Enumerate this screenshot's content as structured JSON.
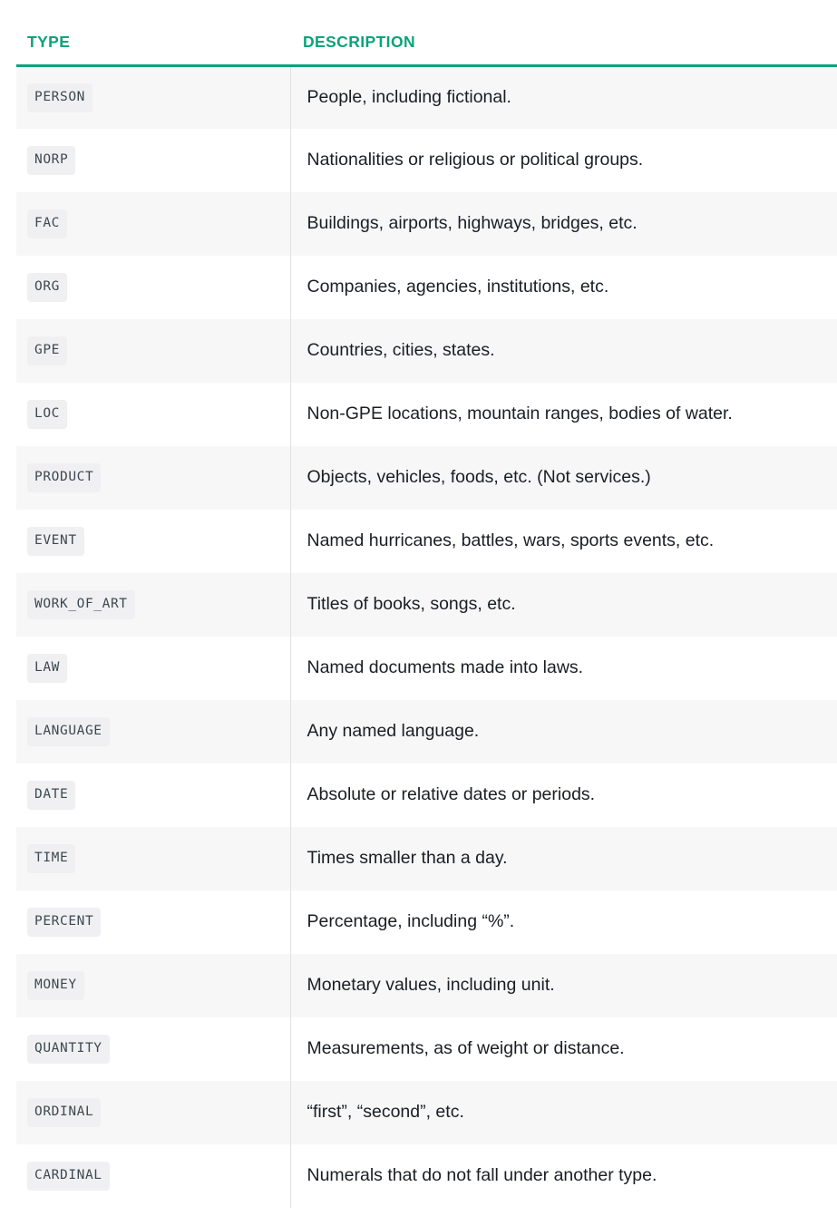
{
  "table": {
    "columns": [
      {
        "key": "type",
        "label": "TYPE"
      },
      {
        "key": "description",
        "label": "DESCRIPTION"
      }
    ],
    "header_accent_color": "#09a37a",
    "badge_background_color": "#f0f0f2",
    "badge_text_color": "#3d4852",
    "row_alt_background_color": "#f7f7f8",
    "row_background_color": "#ffffff",
    "divider_color": "#e1e1e4",
    "rows": [
      {
        "type": "PERSON",
        "description": "People, including fictional."
      },
      {
        "type": "NORP",
        "description": "Nationalities or religious or political groups."
      },
      {
        "type": "FAC",
        "description": "Buildings, airports, highways, bridges, etc."
      },
      {
        "type": "ORG",
        "description": "Companies, agencies, institutions, etc."
      },
      {
        "type": "GPE",
        "description": "Countries, cities, states."
      },
      {
        "type": "LOC",
        "description": "Non-GPE locations, mountain ranges, bodies of water."
      },
      {
        "type": "PRODUCT",
        "description": "Objects, vehicles, foods, etc. (Not services.)"
      },
      {
        "type": "EVENT",
        "description": "Named hurricanes, battles, wars, sports events, etc."
      },
      {
        "type": "WORK_OF_ART",
        "description": "Titles of books, songs, etc."
      },
      {
        "type": "LAW",
        "description": "Named documents made into laws."
      },
      {
        "type": "LANGUAGE",
        "description": "Any named language."
      },
      {
        "type": "DATE",
        "description": "Absolute or relative dates or periods."
      },
      {
        "type": "TIME",
        "description": "Times smaller than a day."
      },
      {
        "type": "PERCENT",
        "description": "Percentage, including “%”."
      },
      {
        "type": "MONEY",
        "description": "Monetary values, including unit."
      },
      {
        "type": "QUANTITY",
        "description": "Measurements, as of weight or distance."
      },
      {
        "type": "ORDINAL",
        "description": "“first”, “second”, etc."
      },
      {
        "type": "CARDINAL",
        "description": "Numerals that do not fall under another type."
      }
    ]
  }
}
